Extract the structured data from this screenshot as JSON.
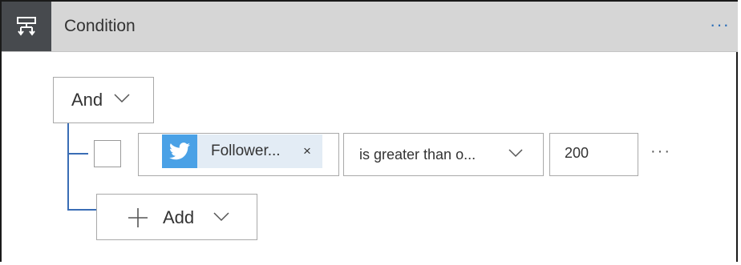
{
  "header": {
    "icon": "condition-icon",
    "title": "Condition",
    "more": "···"
  },
  "group": {
    "operator": "And"
  },
  "row": {
    "token": {
      "icon": "twitter-icon",
      "label": "Follower...",
      "remove": "×"
    },
    "operator": "is greater than o...",
    "value": "200",
    "more": "···"
  },
  "add": {
    "label": "Add"
  },
  "colors": {
    "header_bg": "#d6d6d6",
    "icon_tile": "#474a4e",
    "accent": "#2d6fb8",
    "twitter_blue": "#4aa1e6",
    "token_bg": "#e3ecf5",
    "tree_line": "#3a6db5"
  }
}
